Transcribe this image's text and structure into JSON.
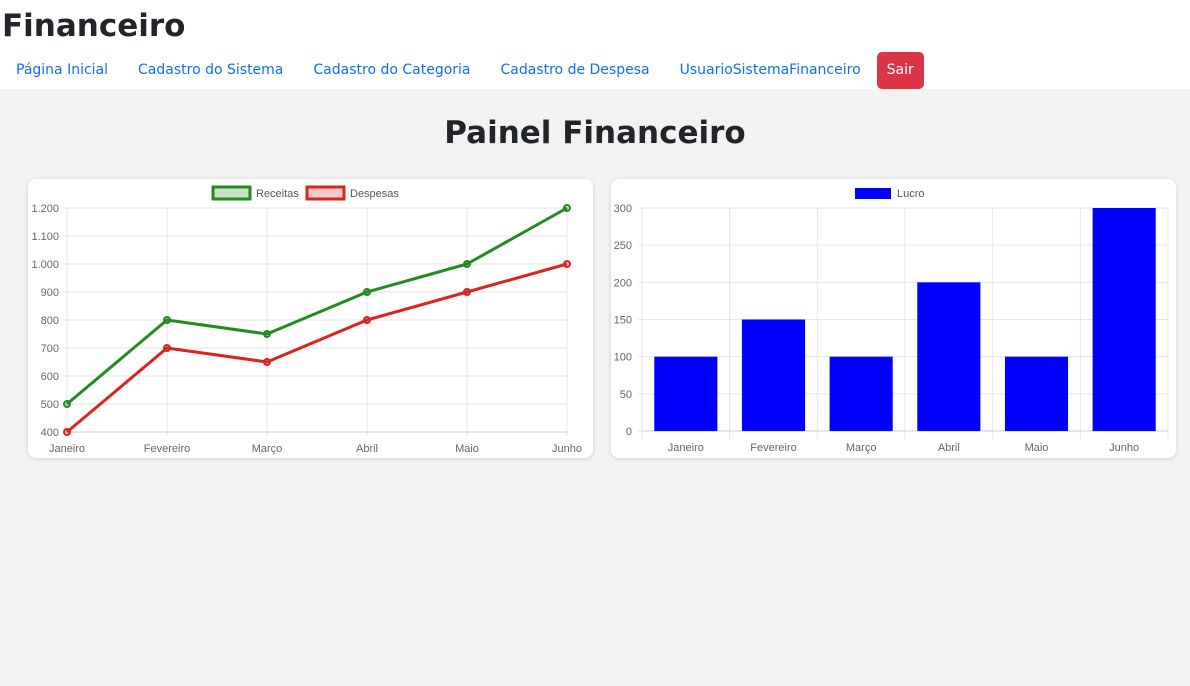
{
  "header": {
    "title": "Financeiro",
    "nav": [
      {
        "label": "Página Inicial"
      },
      {
        "label": "Cadastro do Sistema"
      },
      {
        "label": "Cadastro do Categoria"
      },
      {
        "label": "Cadastro de Despesa"
      },
      {
        "label": "UsuarioSistemaFinanceiro"
      }
    ],
    "logout_label": "Sair"
  },
  "main": {
    "title": "Painel Financeiro"
  },
  "colors": {
    "receitas": "#228b22",
    "despesas": "#dd2222",
    "lucro": "#0000ff",
    "logout": "#dc3545",
    "link": "#0d6efd"
  },
  "chart_data": [
    {
      "type": "line",
      "categories": [
        "Janeiro",
        "Fevereiro",
        "Março",
        "Abril",
        "Maio",
        "Junho"
      ],
      "series": [
        {
          "name": "Receitas",
          "values": [
            500,
            800,
            750,
            900,
            1000,
            1200
          ]
        },
        {
          "name": "Despesas",
          "values": [
            400,
            700,
            650,
            800,
            900,
            1000
          ]
        }
      ],
      "ylim": [
        400,
        1200
      ],
      "y_ticks": [
        "400",
        "500",
        "600",
        "700",
        "800",
        "900",
        "1.000",
        "1.100",
        "1.200"
      ],
      "grid": true,
      "legend": "top-center"
    },
    {
      "type": "bar",
      "categories": [
        "Janeiro",
        "Fevereiro",
        "Março",
        "Abril",
        "Maio",
        "Junho"
      ],
      "series": [
        {
          "name": "Lucro",
          "values": [
            100,
            150,
            100,
            200,
            100,
            300
          ]
        }
      ],
      "ylim": [
        0,
        300
      ],
      "y_ticks": [
        "0",
        "50",
        "100",
        "150",
        "200",
        "250",
        "300"
      ],
      "grid": true,
      "legend": "top-center"
    }
  ]
}
